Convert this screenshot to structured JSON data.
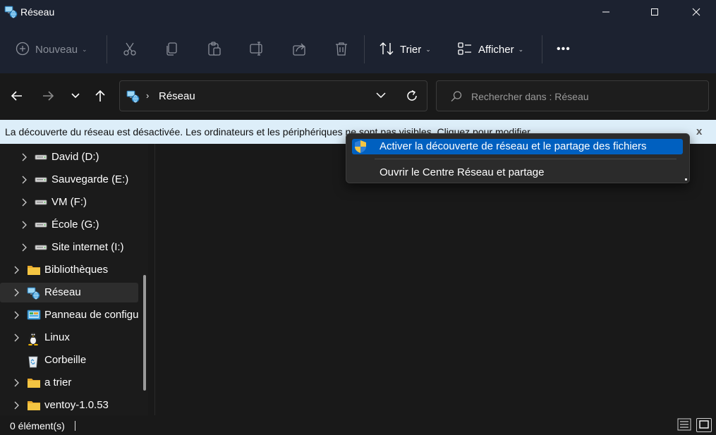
{
  "window": {
    "title": "Réseau",
    "title_icon": "network-icon"
  },
  "toolbar": {
    "new_label": "Nouveau",
    "sort_label": "Trier",
    "view_label": "Afficher",
    "more_label": "•••",
    "icons": [
      "new-icon",
      "cut-icon",
      "copy-icon",
      "paste-icon",
      "rename-icon",
      "share-icon",
      "delete-icon",
      "sort-icon",
      "view-icon",
      "more-icon"
    ]
  },
  "address": {
    "location": "Réseau",
    "separator": "›"
  },
  "search": {
    "placeholder": "Rechercher dans : Réseau"
  },
  "infobar": {
    "message": "La découverte du réseau est désactivée. Les ordinateurs et les périphériques ne sont pas visibles. Cliquez pour modifier...",
    "close": "x"
  },
  "sidebar": {
    "items": [
      {
        "label": "David (D:)",
        "icon": "drive-icon"
      },
      {
        "label": "Sauvegarde (E:)",
        "icon": "drive-icon"
      },
      {
        "label": "VM (F:)",
        "icon": "drive-icon"
      },
      {
        "label": "École (G:)",
        "icon": "drive-icon"
      },
      {
        "label": "Site internet (I:)",
        "icon": "drive-icon"
      },
      {
        "label": "Bibliothèques",
        "icon": "folder-icon"
      },
      {
        "label": "Réseau",
        "icon": "network-icon",
        "selected": true
      },
      {
        "label": "Panneau de configuration",
        "icon": "control-panel-icon"
      },
      {
        "label": "Linux",
        "icon": "linux-icon"
      },
      {
        "label": "Corbeille",
        "icon": "recycle-bin-icon"
      },
      {
        "label": "a trier",
        "icon": "folder-icon"
      },
      {
        "label": "ventoy-1.0.53",
        "icon": "folder-icon"
      }
    ]
  },
  "context_menu": {
    "items": [
      {
        "label": "Activer la découverte de réseau et le partage des fichiers",
        "icon": "uac-shield-icon",
        "highlighted": true
      },
      {
        "label": "Ouvrir le Centre Réseau et partage",
        "icon": ""
      }
    ]
  },
  "statusbar": {
    "count": "0 élément(s)"
  },
  "colors": {
    "titlebar_bg": "#1c2230",
    "window_bg": "#191919",
    "infobar_bg": "#ddeef9",
    "menu_highlight": "#0060c0",
    "folder_yellow": "#f4c542"
  }
}
